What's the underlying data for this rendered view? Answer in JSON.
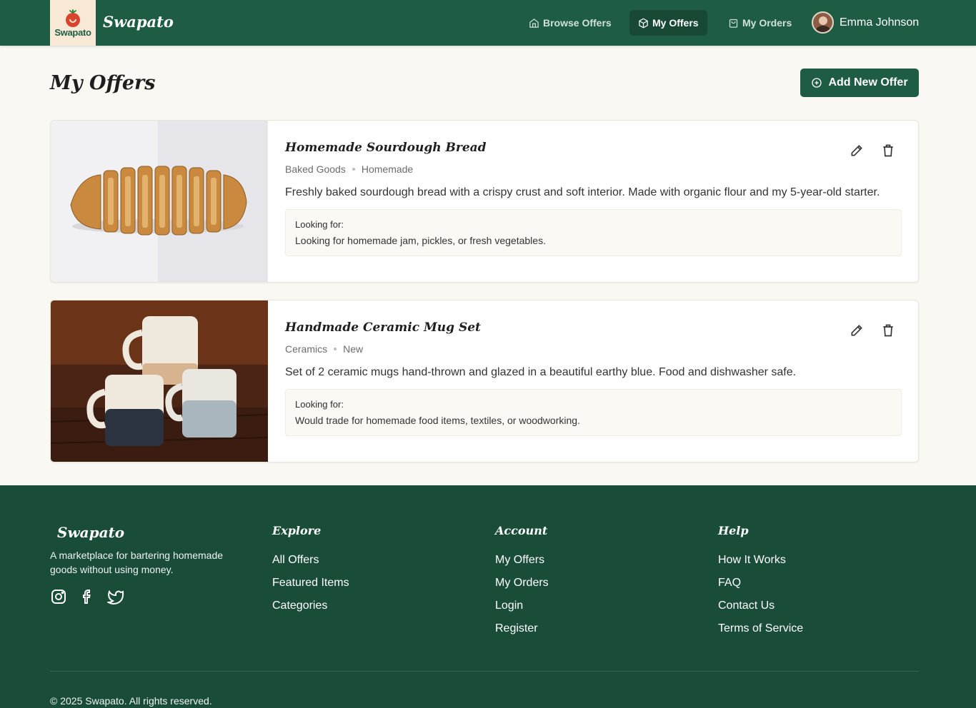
{
  "header": {
    "logo_text": "Swapato",
    "brand": "Swapato",
    "nav": [
      {
        "label": "Browse Offers",
        "icon": "home-icon"
      },
      {
        "label": "My Offers",
        "icon": "package-icon",
        "active": true
      },
      {
        "label": "My Orders",
        "icon": "shopping-bag-icon"
      }
    ],
    "user_name": "Emma Johnson"
  },
  "page": {
    "title": "My Offers",
    "add_button_label": "Add New Offer"
  },
  "offers": [
    {
      "title": "Homemade Sourdough Bread",
      "category": "Baked Goods",
      "condition": "Homemade",
      "description": "Freshly baked sourdough bread with a crispy crust and soft interior. Made with organic flour and my 5-year-old starter.",
      "looking_label": "Looking for:",
      "looking_text": "Looking for homemade jam, pickles, or fresh vegetables."
    },
    {
      "title": "Handmade Ceramic Mug Set",
      "category": "Ceramics",
      "condition": "New",
      "description": "Set of 2 ceramic mugs hand-thrown and glazed in a beautiful earthy blue. Food and dishwasher safe.",
      "looking_label": "Looking for:",
      "looking_text": "Would trade for homemade food items, textiles, or woodworking."
    }
  ],
  "footer": {
    "brand": "Swapato",
    "tagline": "A marketplace for bartering homemade goods without using money.",
    "socials": [
      "instagram-icon",
      "facebook-icon",
      "twitter-icon"
    ],
    "columns": [
      {
        "heading": "Explore",
        "links": [
          "All Offers",
          "Featured Items",
          "Categories"
        ]
      },
      {
        "heading": "Account",
        "links": [
          "My Offers",
          "My Orders",
          "Login",
          "Register"
        ]
      },
      {
        "heading": "Help",
        "links": [
          "How It Works",
          "FAQ",
          "Contact Us",
          "Terms of Service"
        ]
      }
    ],
    "copyright": "© 2025 Swapato. All rights reserved."
  },
  "colors": {
    "primary": "#1f5c44",
    "footer": "#1a4d38",
    "background": "#f9f8f2",
    "logo_bg": "#f7e9d5",
    "accent_red": "#d9442f"
  }
}
